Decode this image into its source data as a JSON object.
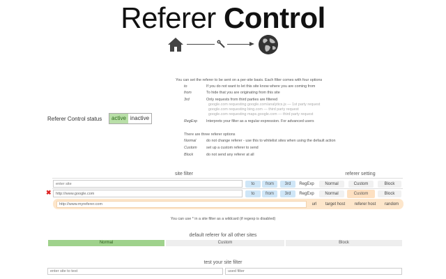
{
  "header": {
    "title_light": "Referer",
    "title_bold": "Control"
  },
  "icons": {
    "home": "home-icon",
    "wrench": "wrench-icon",
    "globe": "globe-icon"
  },
  "help": {
    "intro": "You can set the referer to be sent on a per-site basis. Each filter comes with four options",
    "options": [
      {
        "term": "to",
        "desc": "If you do not want to let this site know where you are coming from"
      },
      {
        "term": "from",
        "desc": "To hide that you are originating from this site"
      },
      {
        "term": "3rd",
        "desc": "Only requests from third parties are filtered"
      }
    ],
    "examples": [
      "google.com requesting google.com/analytics.js — 1st party request",
      "google.com requesting bing.com — third party request",
      "google.com requesting maps.google.com — third party request"
    ],
    "regexp": {
      "term": "RegExp",
      "desc": "Interprets your filter as a regular expression. For advanced users"
    },
    "types_intro": "There are three referer options",
    "types": [
      {
        "term": "Normal",
        "desc": "do not change referer - use this to whitelist sites when using the default action"
      },
      {
        "term": "Custom",
        "desc": "set up a custom referer to send"
      },
      {
        "term": "Block",
        "desc": "do not send any referer at all"
      }
    ]
  },
  "status": {
    "label": "Referer Control status",
    "active": "active",
    "inactive": "inactive"
  },
  "filters": {
    "site_filter_heading": "site filter",
    "referer_setting_heading": "referer setting",
    "new_row": {
      "placeholder": "enter site",
      "opts": [
        "to",
        "from",
        "3rd",
        "RegExp"
      ],
      "settings": [
        "Normal",
        "Custom",
        "Block"
      ]
    },
    "rows": [
      {
        "site": "http://www.google.com",
        "opts": [
          "to",
          "from",
          "3rd",
          "RegExp"
        ],
        "settings": [
          "Normal",
          "Custom",
          "Block"
        ],
        "selected": "Custom",
        "remove": "✖",
        "custom_referer": "http://www.myreferer.com",
        "referer_opts": [
          "url",
          "target host",
          "referer host",
          "random"
        ]
      }
    ],
    "wildcard_note": "You can use * in a site filter as a wildcard (if regexp is disabled)"
  },
  "default_referer": {
    "heading": "default referer for all other sites",
    "options": [
      "Normal",
      "Custom",
      "Block"
    ],
    "selected": "Normal"
  },
  "tester": {
    "heading": "test your site filter",
    "site_placeholder": "enter site to test",
    "result_placeholder": "used filter"
  },
  "colors": {
    "active_green": "#b9dfa8",
    "selected_segment": "#9fd28c",
    "option_blue": "#cfe6f7",
    "custom_orange": "#fde0c1",
    "remove_red": "#dd2222"
  }
}
